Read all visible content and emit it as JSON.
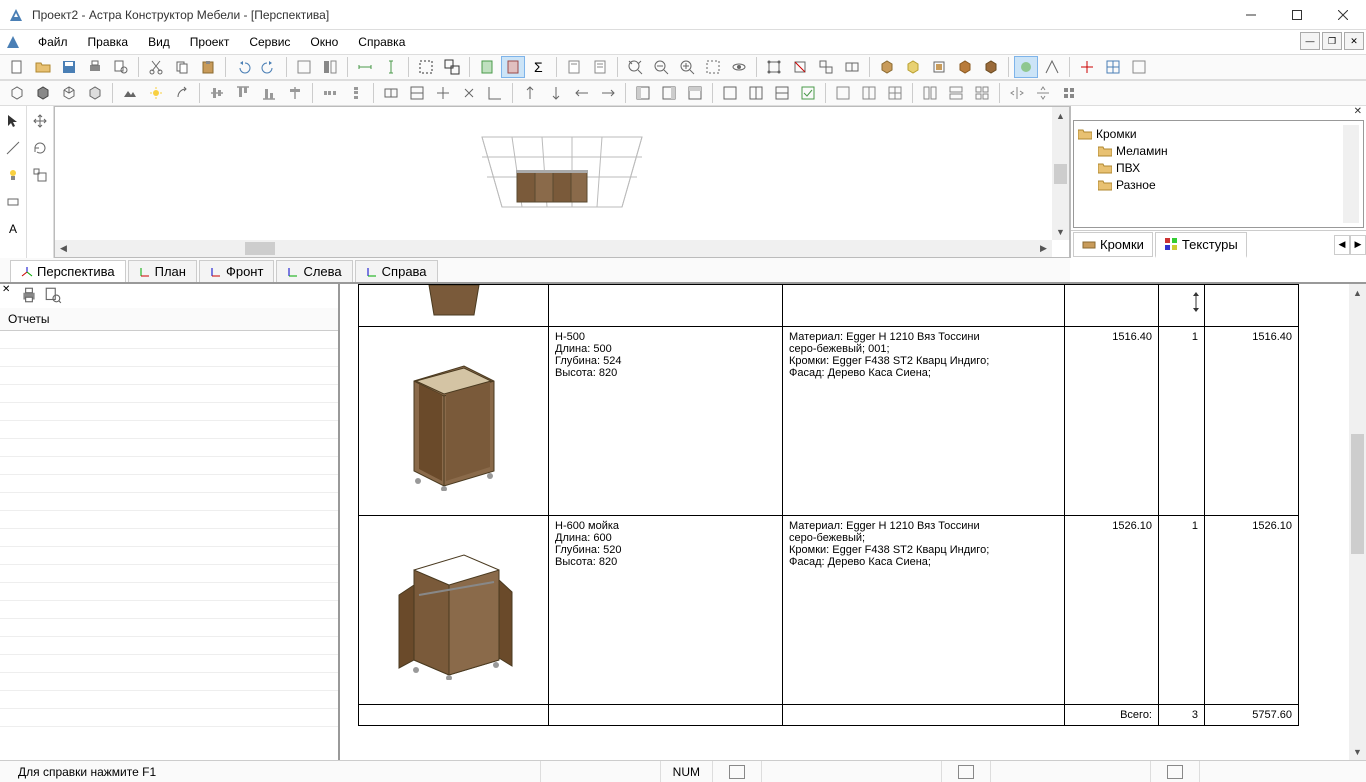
{
  "title": "Проект2 - Астра Конструктор Мебели - [Перспектива]",
  "menus": {
    "file": "Файл",
    "edit": "Правка",
    "view": "Вид",
    "project": "Проект",
    "service": "Сервис",
    "window": "Окно",
    "help": "Справка"
  },
  "viewport": {
    "label": "Перспектива"
  },
  "view_tabs": {
    "perspective": "Перспектива",
    "plan": "План",
    "front": "Фронт",
    "left": "Слева",
    "right": "Справа"
  },
  "tree": {
    "root": "Кромки",
    "children": [
      "Меламин",
      "ПВХ",
      "Разное"
    ]
  },
  "right_tabs": {
    "edges": "Кромки",
    "textures": "Текстуры"
  },
  "report": {
    "list_header": "Отчеты",
    "rows": [
      {
        "name": "Н-500",
        "dims": {
          "l_label": "Длина:",
          "l": "500",
          "d_label": "Глубина:",
          "d": "524",
          "h_label": "Высота:",
          "h": "820"
        },
        "material_l1": "Материал: Egger H 1210 Вяз Тоссини",
        "material_l2": "серо-бежевый; 001;",
        "material_l3": "Кромки: Egger F438 ST2 Кварц Индиго;",
        "material_l4": "Фасад: Дерево Каса Сиена;",
        "price": "1516.40",
        "qty": "1",
        "total": "1516.40"
      },
      {
        "name": "Н-600 мойка",
        "dims": {
          "l_label": "Длина:",
          "l": "600",
          "d_label": "Глубина:",
          "d": "520",
          "h_label": "Высота:",
          "h": "820"
        },
        "material_l1": "Материал: Egger H 1210 Вяз Тоссини",
        "material_l2": "серо-бежевый;",
        "material_l3": "Кромки: Egger F438 ST2 Кварц Индиго;",
        "material_l4": "Фасад: Дерево Каса Сиена;",
        "price": "1526.10",
        "qty": "1",
        "total": "1526.10"
      }
    ],
    "footer": {
      "label": "Всего:",
      "qty": "3",
      "total": "5757.60"
    }
  },
  "status": {
    "help": "Для справки нажмите F1",
    "num": "NUM"
  }
}
